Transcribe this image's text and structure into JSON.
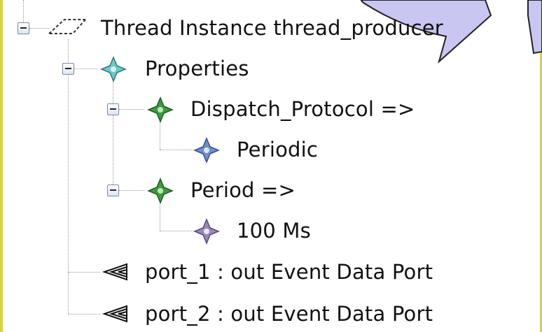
{
  "tree": {
    "root_label": "Thread Instance thread_producer",
    "properties_label": "Properties",
    "dispatch_label": "Dispatch_Protocol =>",
    "dispatch_value": "Periodic",
    "period_label": "Period =>",
    "period_value": "100 Ms",
    "port1_label": "port_1 : out Event Data Port",
    "port2_label": "port_2 : out Event Data Port"
  },
  "icons": {
    "root": "thread-icon",
    "properties": "property-diamond-teal-icon",
    "dispatch": "property-diamond-green-icon",
    "dispatch_value": "value-diamond-blue-icon",
    "period": "property-diamond-green-icon",
    "period_value": "value-diamond-purple-icon",
    "port": "out-event-data-port-icon"
  },
  "colors": {
    "frame_border": "#d8d23c",
    "callout_fill": "#c9c6f2",
    "diamond_teal": "#6fc7c7",
    "diamond_green": "#3d9a3d",
    "diamond_blue": "#6f8fd0",
    "diamond_purple": "#9b86c0"
  }
}
